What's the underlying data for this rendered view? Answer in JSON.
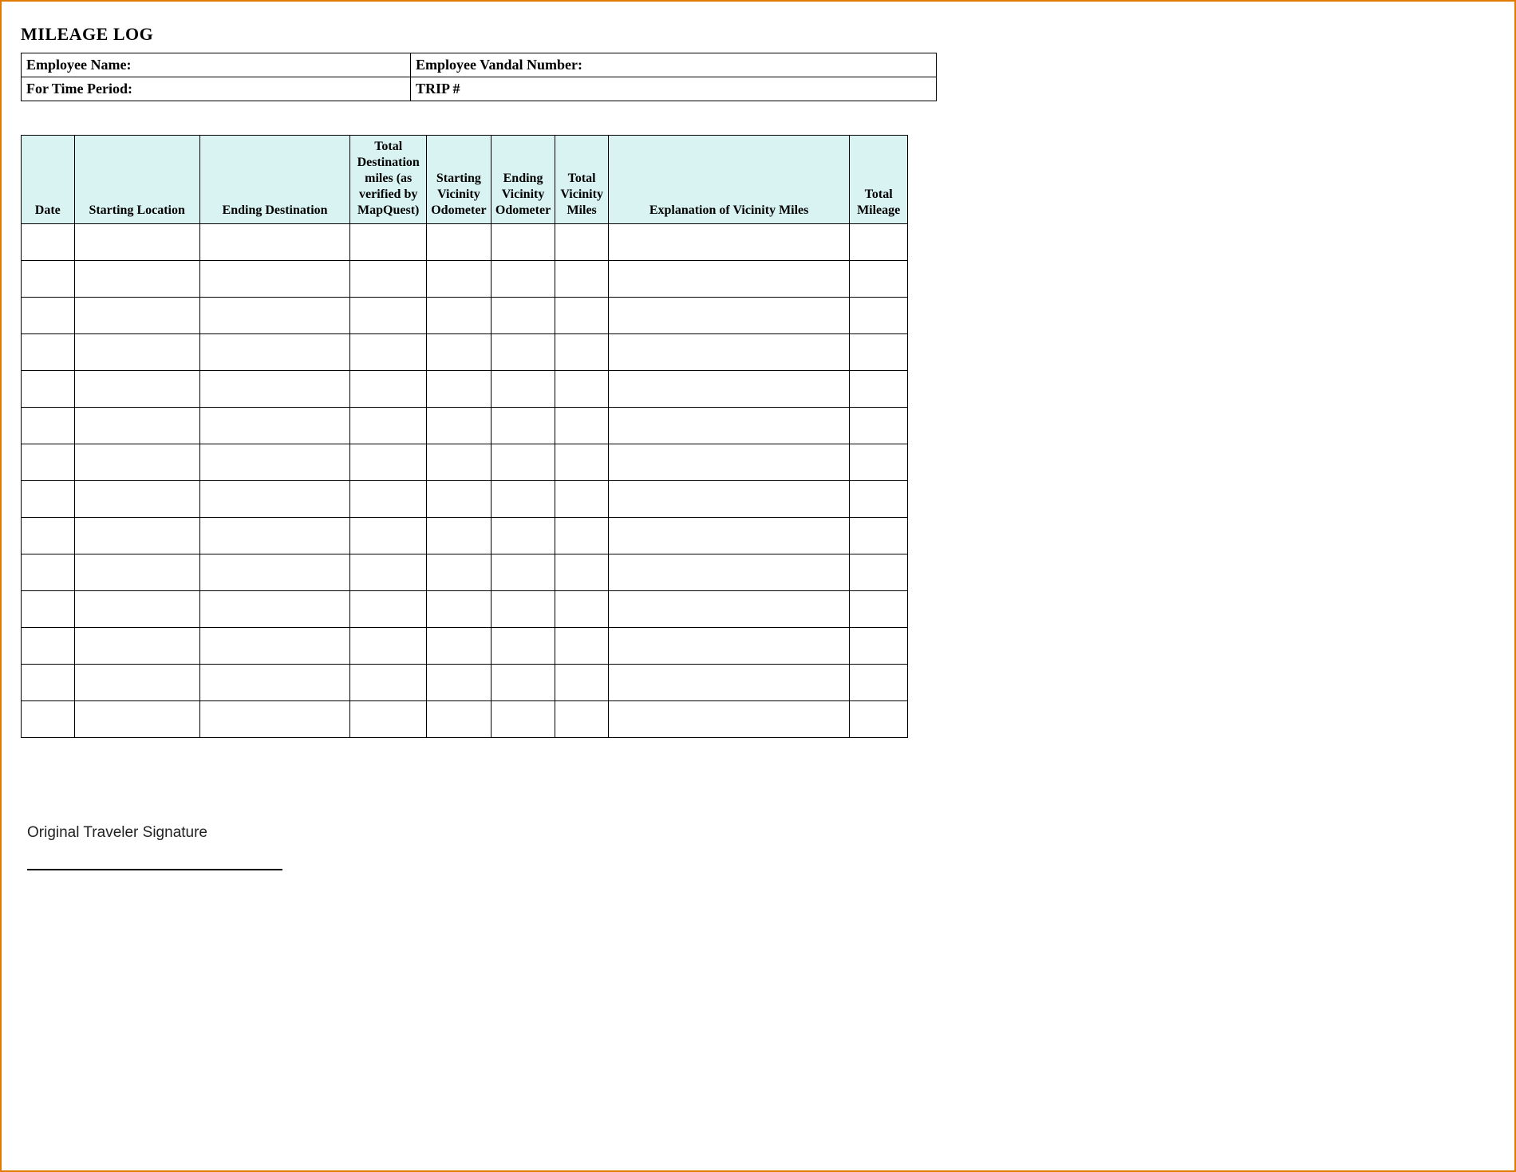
{
  "title": "MILEAGE LOG",
  "info": {
    "employee_name_label": "Employee Name:",
    "employee_vandal_label": "Employee Vandal Number:",
    "time_period_label": "For Time Period:",
    "trip_label": "TRIP #"
  },
  "columns": {
    "date": "Date",
    "starting_location": "Starting Location",
    "ending_destination": "Ending Destination",
    "total_destination_miles": "Total Destination miles (as verified by MapQuest)",
    "starting_vicinity_odometer": "Starting Vicinity Odometer",
    "ending_vicinity_odometer": "Ending Vicinity Odometer",
    "total_vicinity_miles": "Total Vicinity Miles",
    "explanation": "Explanation of Vicinity Miles",
    "total_mileage": "Total Mileage"
  },
  "row_count": 14,
  "signature_label": "Original Traveler Signature"
}
